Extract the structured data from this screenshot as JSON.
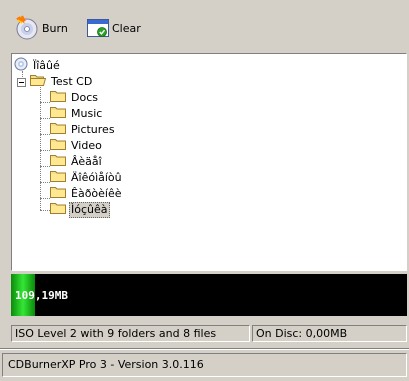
{
  "toolbar": {
    "burn_label": "Burn",
    "clear_label": "Clear"
  },
  "tree": {
    "root": {
      "label": "Ïîâûé",
      "icon": "cd-disc-icon"
    },
    "project": {
      "label": "Test CD",
      "icon": "folder-icon",
      "expanded": true
    },
    "folders": [
      {
        "label": "Docs"
      },
      {
        "label": "Music"
      },
      {
        "label": "Pictures"
      },
      {
        "label": "Video"
      },
      {
        "label": "Âèäåî"
      },
      {
        "label": "Äîêóìåíòû"
      },
      {
        "label": "Êàðòèíêè"
      },
      {
        "label": "Ìóçûêà",
        "selected": true
      }
    ]
  },
  "capacity": {
    "used_text": "109,19MB",
    "fill_fraction": 0.06,
    "colors": {
      "fill": "#35e635",
      "background": "#000000"
    }
  },
  "status": {
    "summary": "ISO Level 2 with 9 folders and 8 files",
    "on_disc": "On Disc: 0,00MB"
  },
  "footer": {
    "version": "CDBurnerXP Pro 3 - Version 3.0.116"
  }
}
